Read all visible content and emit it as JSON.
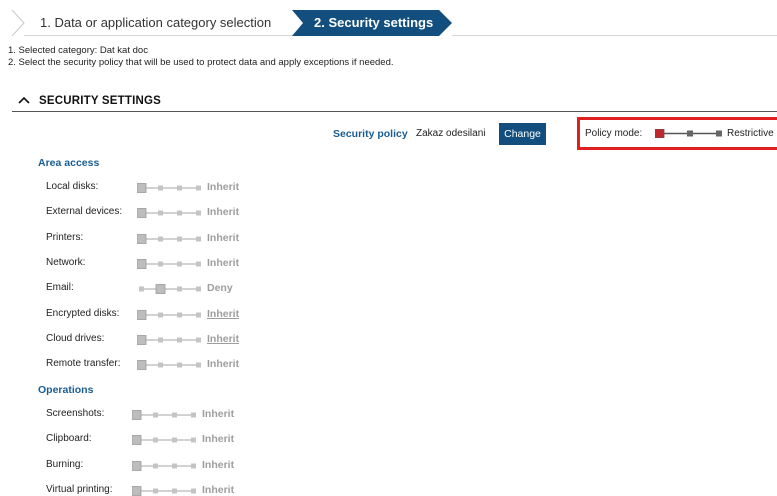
{
  "wizard": {
    "steps": [
      {
        "label": "1. Data or application category selection",
        "active": false
      },
      {
        "label": "2. Security settings",
        "active": true
      }
    ],
    "active_color": "#124f7e"
  },
  "instructions": [
    "1. Selected category: Dat kat doc",
    "2. Select the security policy that will be used to protect data and apply exceptions if needed."
  ],
  "section": {
    "title": "SECURITY SETTINGS",
    "expanded": true
  },
  "policy": {
    "label": "Security policy",
    "value": "Zakaz odesilani",
    "change_label": "Change",
    "mode_label": "Policy mode:",
    "mode_value": "Restrictive",
    "mode_level": 0,
    "highlight_color": "#e02020"
  },
  "area_access": {
    "heading": "Area access",
    "items": [
      {
        "label": "Local disks:",
        "value": "Inherit",
        "level": 0,
        "link": false
      },
      {
        "label": "External devices:",
        "value": "Inherit",
        "level": 0,
        "link": false
      },
      {
        "label": "Printers:",
        "value": "Inherit",
        "level": 0,
        "link": false
      },
      {
        "label": "Network:",
        "value": "Inherit",
        "level": 0,
        "link": false
      },
      {
        "label": "Email:",
        "value": "Deny",
        "level": 1,
        "link": false
      },
      {
        "label": "Encrypted disks:",
        "value": "Inherit",
        "level": 0,
        "link": true
      },
      {
        "label": "Cloud drives:",
        "value": "Inherit",
        "level": 0,
        "link": true
      },
      {
        "label": "Remote transfer:",
        "value": "Inherit",
        "level": 0,
        "link": false
      }
    ]
  },
  "operations": {
    "heading": "Operations",
    "items": [
      {
        "label": "Screenshots:",
        "value": "Inherit",
        "level": 0,
        "link": false
      },
      {
        "label": "Clipboard:",
        "value": "Inherit",
        "level": 0,
        "link": false
      },
      {
        "label": "Burning:",
        "value": "Inherit",
        "level": 0,
        "link": false
      },
      {
        "label": "Virtual printing:",
        "value": "Inherit",
        "level": 0,
        "link": false
      }
    ]
  }
}
